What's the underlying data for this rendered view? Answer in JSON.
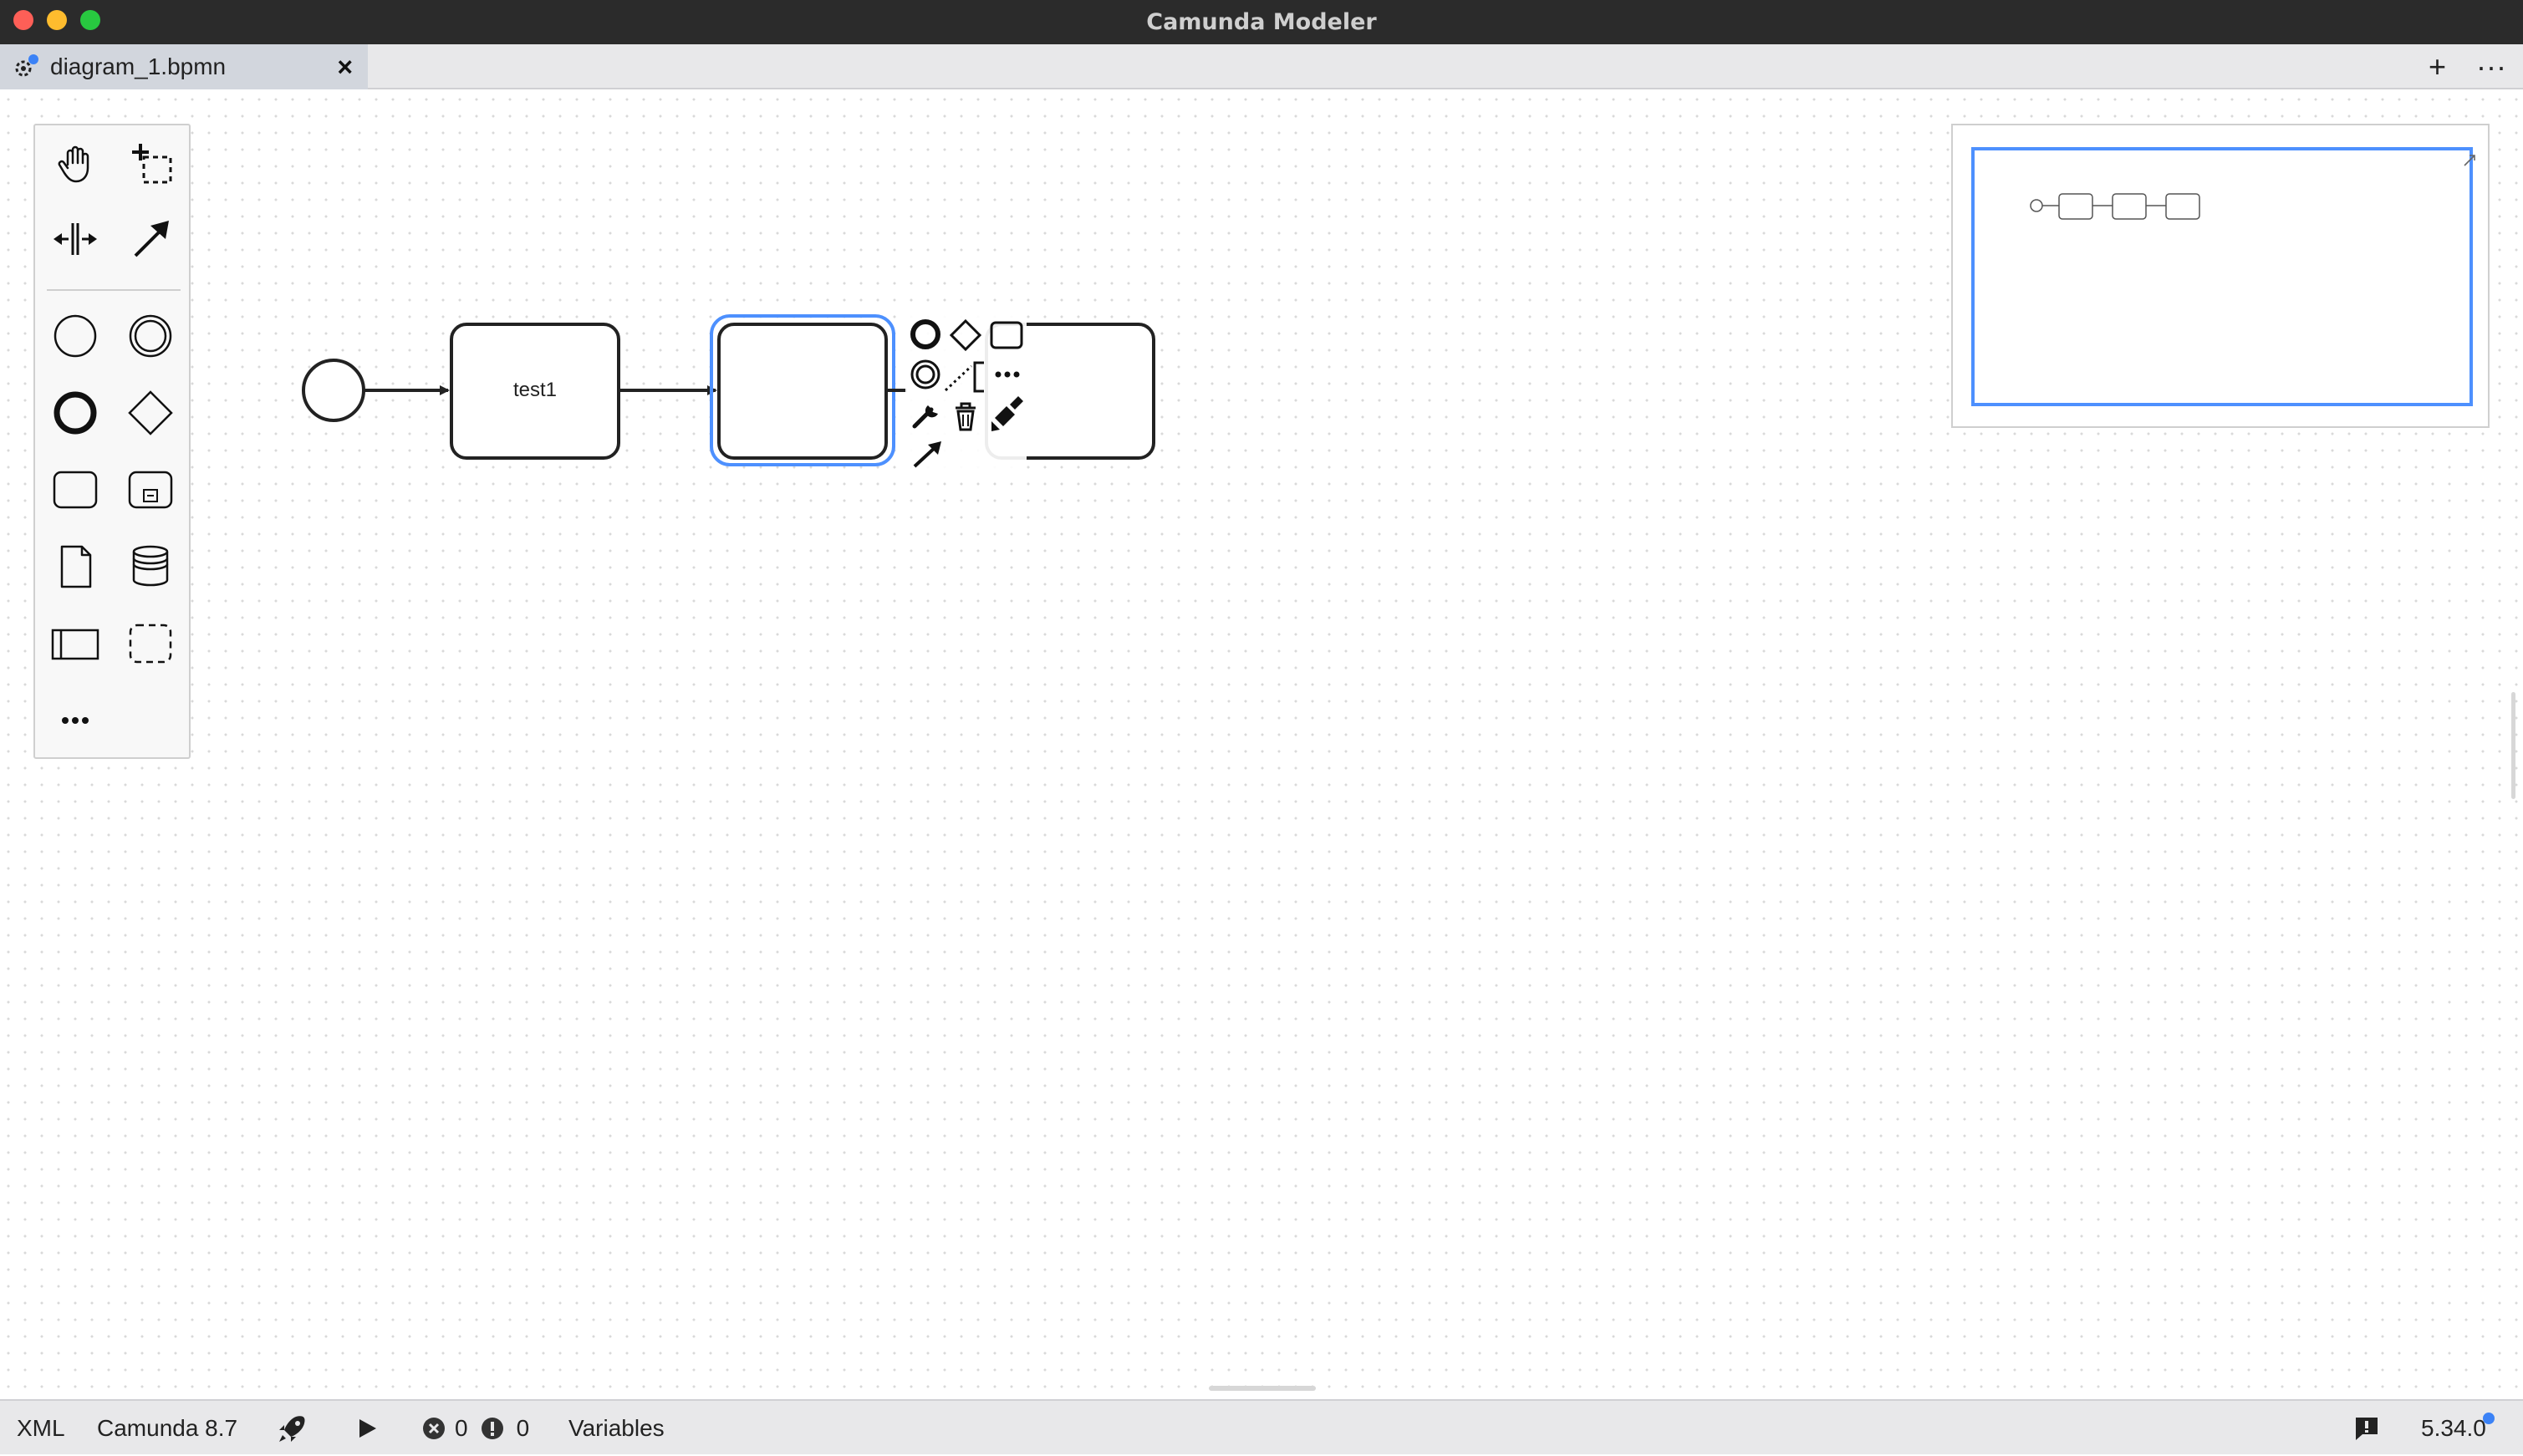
{
  "window": {
    "title": "Camunda Modeler"
  },
  "tabs": [
    {
      "label": "diagram_1.bpmn",
      "close": "×"
    }
  ],
  "tabbar_actions": {
    "new_tab": "+",
    "more": "···"
  },
  "diagram": {
    "tasks": [
      {
        "label": "test1"
      },
      {
        "label": "",
        "selected": true
      },
      {
        "label": ""
      }
    ]
  },
  "statusbar": {
    "xml": "XML",
    "engine": "Camunda 8.7",
    "errors": "0",
    "warnings": "0",
    "variables": "Variables",
    "version": "5.34.0"
  },
  "colors": {
    "selection": "#4d90fe",
    "titlebar": "#2b2b2b",
    "tab_active": "#d2d6dd",
    "tab_dot": "#3b82f6"
  }
}
